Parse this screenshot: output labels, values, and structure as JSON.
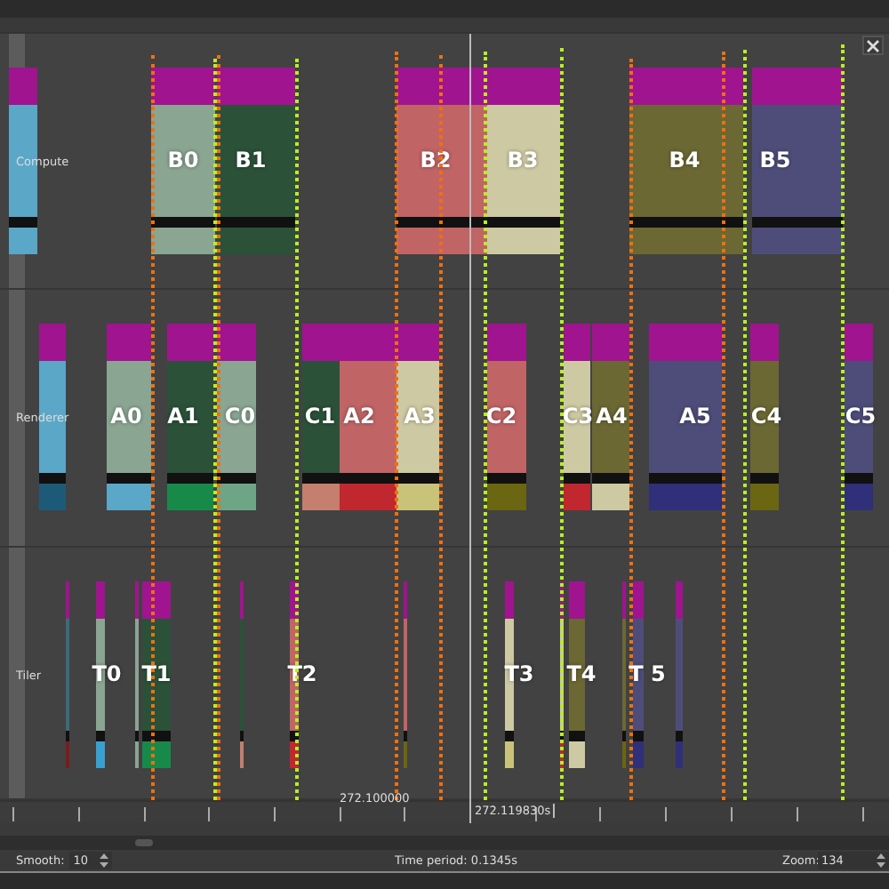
{
  "lanes": [
    {
      "name": "Compute",
      "blocks": [
        {
          "color": "#5aa7c8",
          "footer": {
            "color": "#5aa7c8"
          }
        },
        {
          "label": "B0",
          "color": "#8aa592",
          "footer": {
            "color": "#8aa592"
          }
        },
        {
          "label": "B1",
          "color": "#2b5139",
          "footer": {
            "color": "#2b5139"
          }
        },
        {
          "label": "B2",
          "color": "#c06466",
          "footer": {
            "color": "#c06466"
          }
        },
        {
          "label": "B3",
          "color": "#cdc9a2",
          "footer": {
            "color": "#cdc9a2"
          }
        },
        {
          "label": "B4",
          "color": "#6b6833",
          "footer": {
            "color": "#6b6833"
          }
        },
        {
          "label": "B5",
          "color": "#4e4d7a",
          "footer": {
            "color": "#4e4d7a"
          }
        }
      ]
    },
    {
      "name": "Renderer",
      "blocks": [
        {
          "color": "#5aa7c8",
          "footer": {
            "color": "#1d5a78"
          }
        },
        {
          "label": "A0",
          "color": "#8aa592",
          "footer": {
            "color": "#5aa7c8"
          }
        },
        {
          "label": "A1",
          "color": "#2b5139",
          "footer": {
            "color": "#178a4a"
          }
        },
        {
          "label": "C0",
          "color": "#8aa592",
          "footer": {
            "color": "#6fa587"
          }
        },
        {
          "label": "C1",
          "color": "#2b5139",
          "footer": {
            "color": "#c47f6e"
          }
        },
        {
          "label": "A2",
          "color": "#c06466",
          "footer": {
            "color": "#c0272e"
          }
        },
        {
          "label": "A3",
          "color": "#cdc9a2",
          "footer": {
            "color": "#c9c37a"
          }
        },
        {
          "label": "C2",
          "color": "#c06466",
          "footer": {
            "color": "#6b6611"
          }
        },
        {
          "label": "C3",
          "color": "#cdc9a2",
          "footer": {
            "color": "#c0272e"
          }
        },
        {
          "label": "A4",
          "color": "#6b6833",
          "footer": {
            "color": "#cdc9a2"
          }
        },
        {
          "label": "A5",
          "color": "#4e4d7a",
          "footer": {
            "color": "#2f2f7a"
          }
        },
        {
          "label": "C4",
          "color": "#6b6833",
          "footer": {
            "color": "#6b6611"
          }
        },
        {
          "label": "C5",
          "color": "#4e4d7a",
          "footer": {
            "color": "#2f2f7a"
          }
        }
      ]
    },
    {
      "name": "Tiler",
      "blocks": [
        {
          "color": "#3c6b78",
          "footer": {
            "color": "#7a1c1c"
          }
        },
        {
          "label": "T0",
          "color": "#8aa592",
          "footer": {
            "color": "#3aa0d0"
          }
        },
        {
          "color": "#8aa592",
          "footer": {
            "color": "#8aa592"
          }
        },
        {
          "label": "T1",
          "color": "#2b5139",
          "footer": {
            "color": "#178a4a"
          }
        },
        {
          "color": "#2b5139",
          "footer": {
            "color": "#c08070"
          }
        },
        {
          "label": "T2",
          "color": "#c06466",
          "footer": {
            "color": "#c0272e"
          }
        },
        {
          "color": "#c06466",
          "footer": {
            "color": "#6b6611"
          }
        },
        {
          "label": "T3",
          "color": "#cdc9a2",
          "footer": {
            "color": "#c9c37a"
          }
        },
        {
          "color": "#cdc9a2",
          "footer": {
            "color": "#c0272e"
          }
        },
        {
          "label": "T4",
          "color": "#6b6833",
          "footer": {
            "color": "#cdc9a2"
          }
        },
        {
          "color": "#6b6833",
          "footer": {
            "color": "#6b6611"
          }
        },
        {
          "label": "T 5",
          "color": "#4e4d7a",
          "footer": {
            "color": "#2f2f7a"
          }
        },
        {
          "color": "#4e4d7a",
          "footer": {
            "color": "#2f2f7a"
          }
        }
      ]
    }
  ],
  "ruler": {
    "tick_label": "272.100000",
    "cursor_label": "272.119830s"
  },
  "status_bar": {
    "smooth_label": "Smooth:",
    "smooth_value": "10",
    "time_period": "Time period: 0.1345s",
    "zoom_label": "Zoom:",
    "zoom_value": "134"
  }
}
